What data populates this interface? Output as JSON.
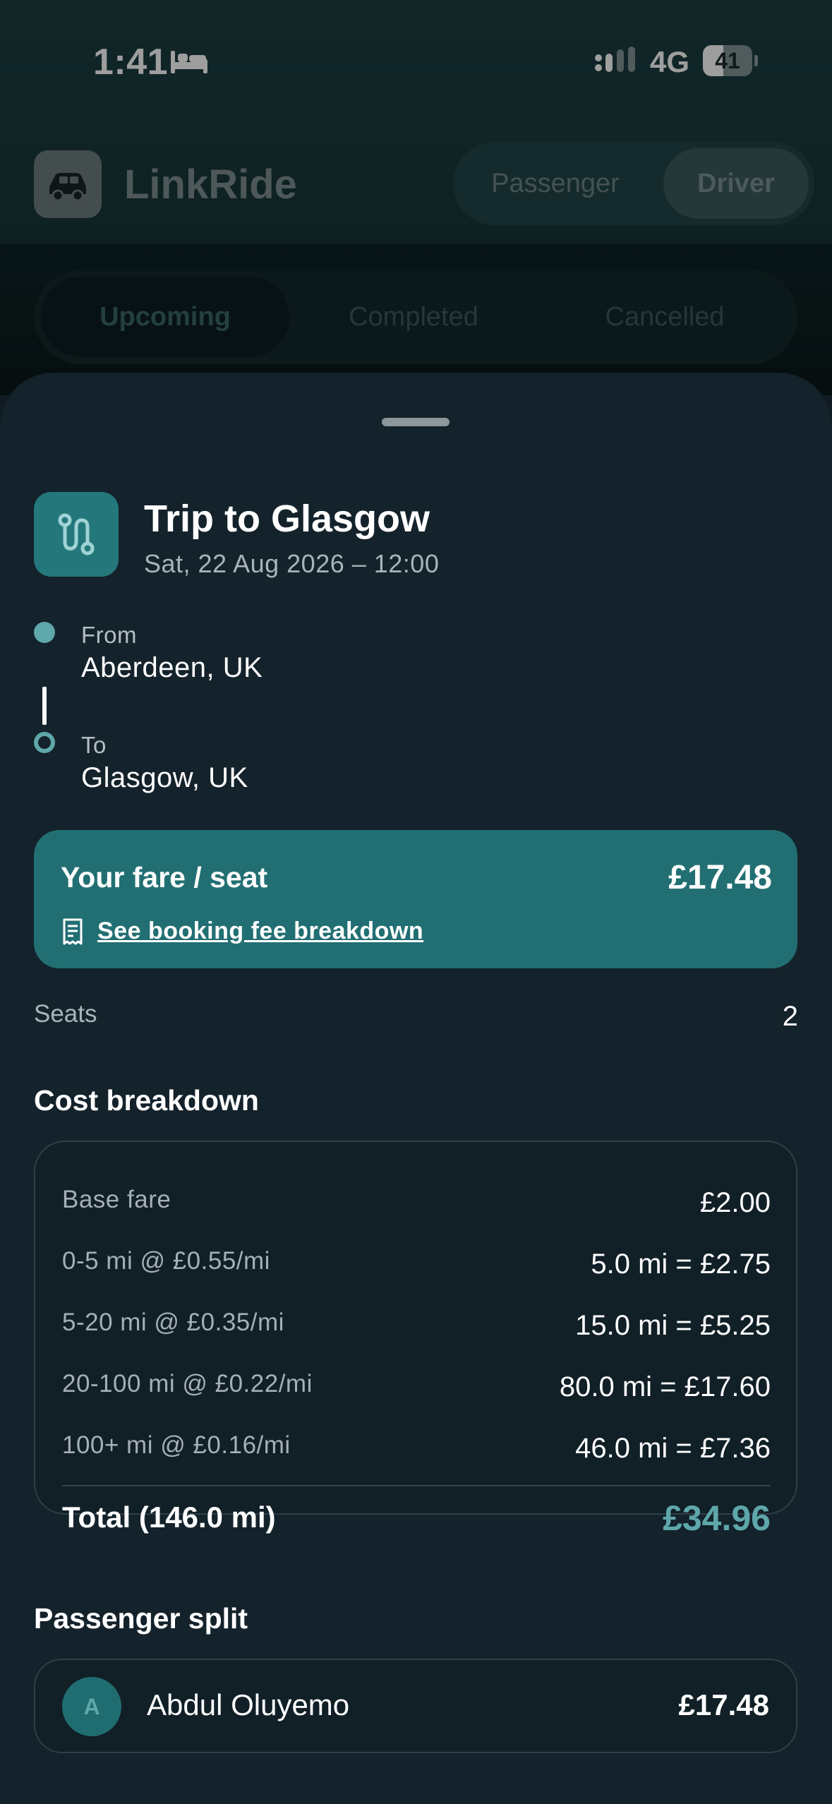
{
  "status_bar": {
    "time": "1:41",
    "network": "4G",
    "battery": "41",
    "battery_level": 0.41
  },
  "app": {
    "name": "LinkRide",
    "roles": [
      "Passenger",
      "Driver"
    ],
    "active_role": "Driver"
  },
  "tabs": [
    {
      "label": "Upcoming",
      "active": true
    },
    {
      "label": "Completed",
      "active": false
    },
    {
      "label": "Cancelled",
      "active": false
    }
  ],
  "trip": {
    "title": "Trip to Glasgow",
    "datetime": "Sat, 22 Aug 2026 – 12:00",
    "from_label": "From",
    "from_value": "Aberdeen, UK",
    "to_label": "To",
    "to_value": "Glasgow, UK"
  },
  "fare": {
    "label": "Your fare / seat",
    "value": "£17.48",
    "link_label": "See booking fee breakdown"
  },
  "seats": {
    "label": "Seats",
    "value": "2"
  },
  "cost_breakdown": {
    "title": "Cost breakdown",
    "rows": [
      {
        "label": "Base fare",
        "value": "£2.00"
      },
      {
        "label": "0-5 mi @ £0.55/mi",
        "value": "5.0 mi = £2.75"
      },
      {
        "label": "5-20 mi @ £0.35/mi",
        "value": "15.0 mi = £5.25"
      },
      {
        "label": "20-100 mi @ £0.22/mi",
        "value": "80.0 mi = £17.60"
      },
      {
        "label": "100+ mi @ £0.16/mi",
        "value": "46.0 mi = £7.36"
      }
    ],
    "total_label": "Total (146.0 mi)",
    "total_value": "£34.96"
  },
  "passenger_split": {
    "title": "Passenger split",
    "passengers": [
      {
        "initial": "A",
        "name": "Abdul Oluyemo",
        "amount": "£17.48"
      }
    ]
  },
  "colors": {
    "accent": "#5ea7aa",
    "fare_card": "#226f73",
    "sheet_bg": "#14222b"
  }
}
